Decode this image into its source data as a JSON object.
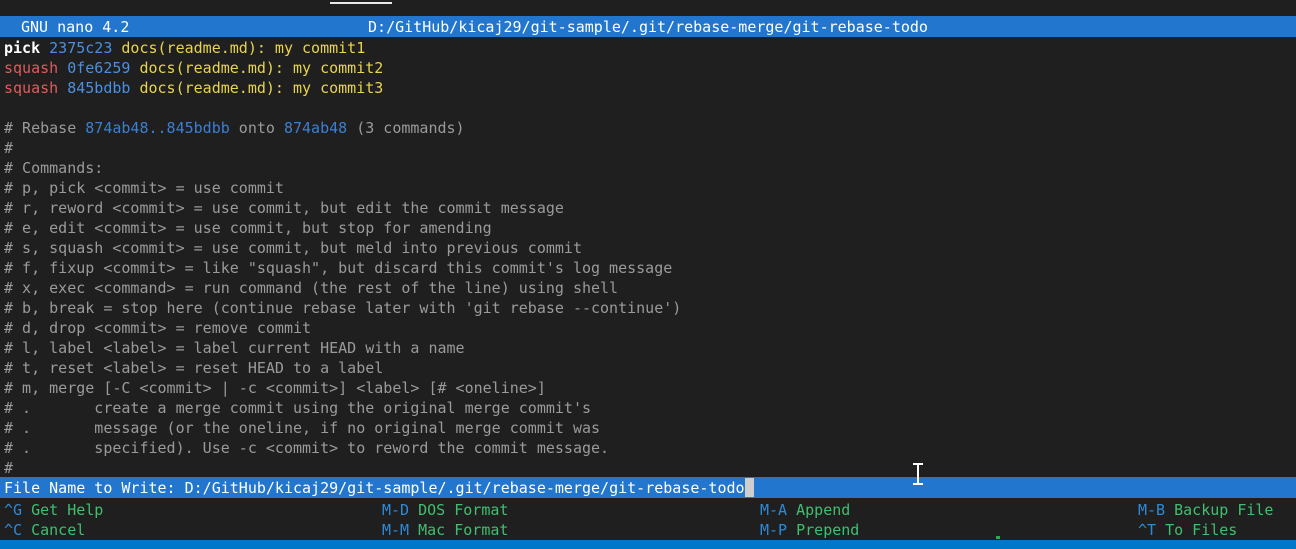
{
  "titlebar": {
    "app": "GNU nano 4.2",
    "path": "D:/GitHub/kicaj29/git-sample/.git/rebase-merge/git-rebase-todo"
  },
  "todo_lines": [
    {
      "cmd": "pick",
      "cmd_style": "pick",
      "hash": "2375c23",
      "message": "docs(readme.md): my commit1"
    },
    {
      "cmd": "squash",
      "cmd_style": "squash",
      "hash": "0fe6259",
      "message": "docs(readme.md): my commit2"
    },
    {
      "cmd": "squash",
      "cmd_style": "squash",
      "hash": "845bdbb",
      "message": "docs(readme.md): my commit3"
    }
  ],
  "rebase_header": {
    "prefix": "# Rebase ",
    "range": "874ab48..845bdbb",
    "middle": " onto ",
    "onto": "874ab48",
    "suffix": " (3 commands)"
  },
  "comment_lines": [
    "#",
    "# Commands:",
    "# p, pick <commit> = use commit",
    "# r, reword <commit> = use commit, but edit the commit message",
    "# e, edit <commit> = use commit, but stop for amending",
    "# s, squash <commit> = use commit, but meld into previous commit",
    "# f, fixup <commit> = like \"squash\", but discard this commit's log message",
    "# x, exec <command> = run command (the rest of the line) using shell",
    "# b, break = stop here (continue rebase later with 'git rebase --continue')",
    "# d, drop <commit> = remove commit",
    "# l, label <label> = label current HEAD with a name",
    "# t, reset <label> = reset HEAD to a label",
    "# m, merge [-C <commit> | -c <commit>] <label> [# <oneline>]",
    "# .       create a merge commit using the original merge commit's",
    "# .       message (or the oneline, if no original merge commit was",
    "# .       specified). Use -c <commit> to reword the commit message.",
    "#"
  ],
  "prompt": {
    "label": "File Name to Write: ",
    "value": "D:/GitHub/kicaj29/git-sample/.git/rebase-merge/git-rebase-todo"
  },
  "shortcuts": {
    "row1": [
      {
        "key": "^G",
        "label": "Get Help"
      },
      {
        "key": "M-D",
        "label": "DOS Format"
      },
      {
        "key": "M-A",
        "label": "Append"
      },
      {
        "key": "M-B",
        "label": "Backup File"
      }
    ],
    "row2": [
      {
        "key": "^C",
        "label": "Cancel"
      },
      {
        "key": "M-M",
        "label": "Mac Format"
      },
      {
        "key": "M-P",
        "label": "Prepend"
      },
      {
        "key": "^T",
        "label": "To Files"
      }
    ]
  },
  "colors": {
    "background": "#1f1f1f",
    "accent_blue": "#2276ce",
    "taskbar_blue": "#0077c8",
    "hash_blue": "#4a90e2",
    "message_yellow": "#e8d44d",
    "squash_red": "#e05c5c",
    "comment_gray": "#9a9a9a",
    "key_blue": "#2d8ad8",
    "key_label_green": "#3fbf6f"
  }
}
